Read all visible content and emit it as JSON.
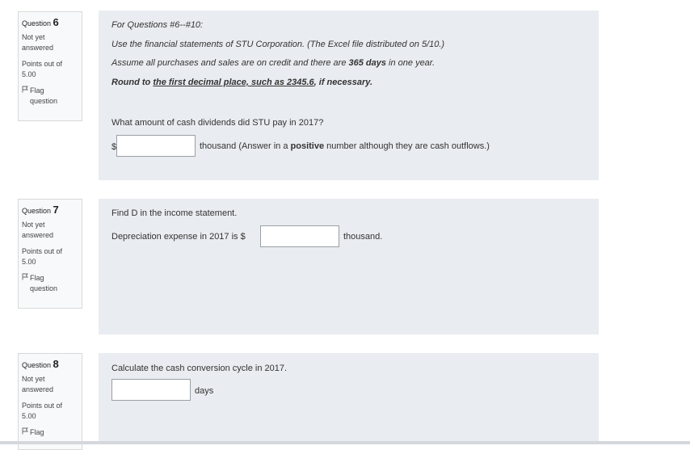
{
  "questions": [
    {
      "label": "Question",
      "number": "6",
      "status": "Not yet answered",
      "points": "Points out of 5.00",
      "flag": "Flag question",
      "intro": {
        "heading": "For Questions #6--#10:",
        "line1": "Use the financial statements of STU Corporation. (The Excel file distributed on 5/10.)",
        "line2_pre": "Assume all purchases and sales are on credit and there are ",
        "line2_bold": "365 days",
        "line2_post": " in one year.",
        "line3_pre": "Round to ",
        "line3_under": "the first decimal place, such as 2345.6",
        "line3_post": ", if necessary."
      },
      "prompt": "What amount of cash dividends did STU pay in 2017?",
      "currency": "$",
      "answer_value": "",
      "suffix_pre": "thousand (Answer in a ",
      "suffix_bold": "positive",
      "suffix_post": " number although they are cash outflows.)"
    },
    {
      "label": "Question",
      "number": "7",
      "status": "Not yet answered",
      "points": "Points out of 5.00",
      "flag": "Flag question",
      "prompt": "Find D in the income statement.",
      "sentence_pre": "Depreciation expense in 2017 is $",
      "answer_value": "",
      "suffix": "thousand."
    },
    {
      "label": "Question",
      "number": "8",
      "status": "Not yet answered",
      "points": "Points out of 5.00",
      "flag": "Flag",
      "prompt": "Calculate the cash conversion cycle in 2017.",
      "answer_value": "",
      "suffix": "days"
    }
  ],
  "colors": {
    "content_bg": "#e9ecf0",
    "info_bg": "#f8f9fa",
    "info_border": "#d9d9d9"
  },
  "icons": {
    "flag": "flag-outline-icon"
  }
}
